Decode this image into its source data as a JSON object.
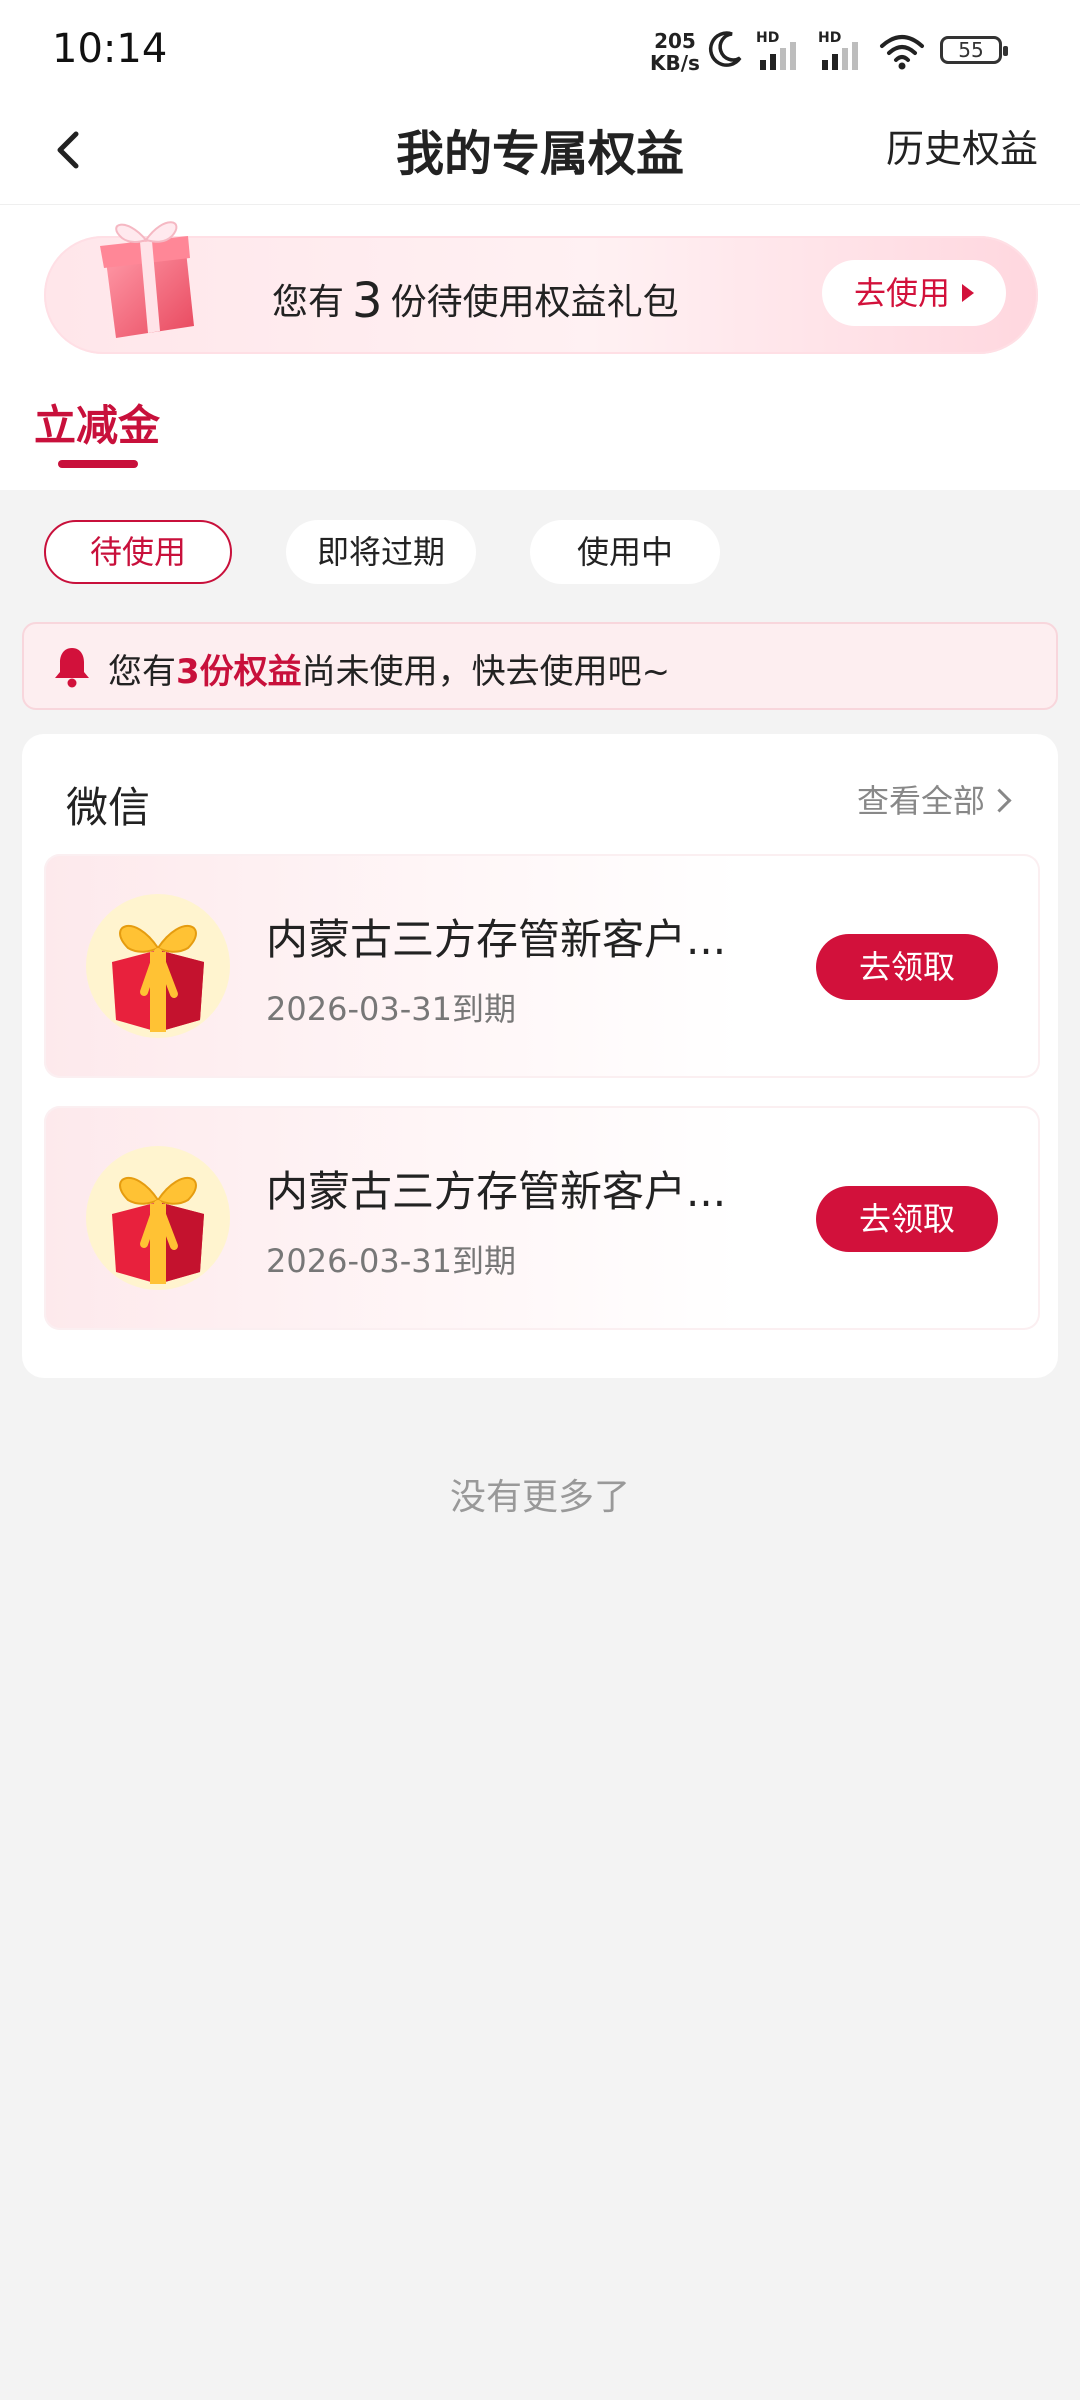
{
  "status_bar": {
    "time": "10:14",
    "net_speed_value": "205",
    "net_speed_unit": "KB/s",
    "sim1_label": "HD",
    "sim2_label": "HD",
    "battery": "55"
  },
  "header": {
    "back_icon": "chevron-left-icon",
    "title": "我的专属权益",
    "history_label": "历史权益"
  },
  "banner": {
    "icon": "gift-box-icon",
    "text_prefix": "您有",
    "count": "3",
    "text_suffix": "份待使用权益礼包",
    "button_label": "去使用"
  },
  "category_tab": {
    "label": "立减金"
  },
  "filters": [
    {
      "label": "待使用",
      "active": true
    },
    {
      "label": "即将过期",
      "active": false
    },
    {
      "label": "使用中",
      "active": false
    }
  ],
  "notice": {
    "icon": "bell-icon",
    "prefix": "您有",
    "highlight": "3份权益",
    "suffix": "尚未使用，快去使用吧~"
  },
  "card": {
    "title": "微信",
    "view_all_label": "查看全部",
    "items": [
      {
        "name": "内蒙古三方存管新客户...",
        "expiry": "2026-03-31到期",
        "button_label": "去领取"
      },
      {
        "name": "内蒙古三方存管新客户...",
        "expiry": "2026-03-31到期",
        "button_label": "去领取"
      }
    ]
  },
  "footer_note": "没有更多了",
  "colors": {
    "accent": "#c8103b",
    "button_red": "#d2113b",
    "page_bg": "#f3f3f3",
    "notice_bg": "#fdeef0"
  }
}
